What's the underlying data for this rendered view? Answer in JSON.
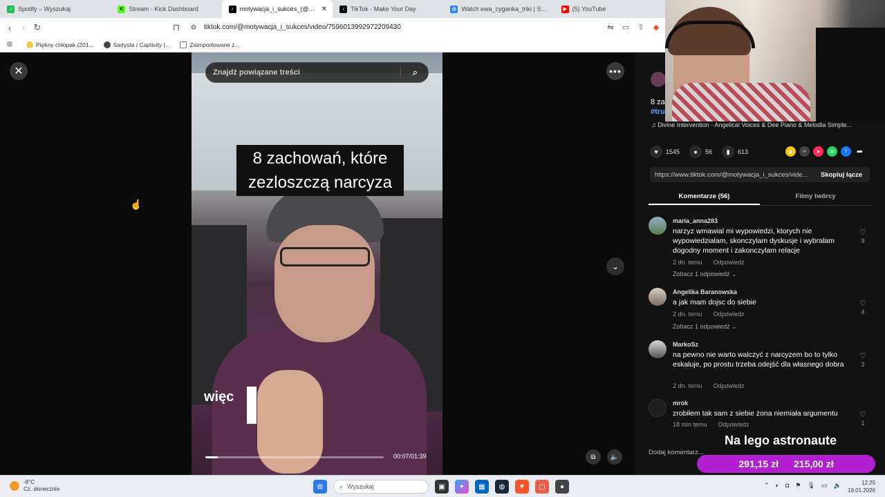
{
  "browser": {
    "tabs": [
      {
        "title": "Spotify – Wyszukaj",
        "color": "#1db954",
        "glyph": "♫"
      },
      {
        "title": "Stream - Kick Dashboard",
        "color": "#53fc18",
        "glyph": "K"
      },
      {
        "title": "motywacja_i_sukces_(@mot",
        "color": "#000000",
        "glyph": "♪",
        "active": true
      },
      {
        "title": "TikTok - Make Your Day",
        "color": "#000000",
        "glyph": "♪"
      },
      {
        "title": "Watch ewa_cyganka_triki | Streamab",
        "color": "#2b80ff",
        "glyph": "◎"
      },
      {
        "title": "(5) YouTube",
        "color": "#ff0000",
        "glyph": "▶"
      }
    ],
    "url": "tiktok.com/@motywacja_i_sukces/video/7596013992972209430",
    "bookmarks": [
      {
        "label": "Piękny chłopak (201...",
        "color": "#f2c94c"
      },
      {
        "label": "Sadysta / Captivity (...",
        "color": "#444444"
      },
      {
        "label": "Zaimportowane z...",
        "color": "#888888"
      }
    ]
  },
  "viewer": {
    "search_placeholder": "Znajdź powiązane treści",
    "caption": "8 zachowań, które zezloszczą narcyza",
    "subtitle": "więc",
    "time": "00:07/01:39",
    "progress_fraction": 0.07
  },
  "panel": {
    "title_fragment": "8 za",
    "hashtag_fragment": "#tru",
    "music": "♫  Divine Intervention - Angelical Voices & Dee Piano & Melodia Simple...",
    "stats": {
      "likes": "1545",
      "comments": "56",
      "saves": "613"
    },
    "link": "https://www.tiktok.com/@motywacja_i_sukces/vide...",
    "copy_label": "Skopiuj łącze",
    "tabs": {
      "comments": "Komentarze (56)",
      "creator_videos": "Filmy twórcy"
    },
    "comments": [
      {
        "user": "maria_anna283",
        "text": "narzyz wmawial mi wypowiedzi, ktorych nie wypowiedzialam, skonczylam dyskusje i wybralam dogodny moment i zakonczylam relacje",
        "time": "2 dn. temu",
        "reply": "Odpowiedz",
        "likes": "9",
        "more": "Zobacz 1 odpowiedź ⌄",
        "avatar": "#6b8fa0"
      },
      {
        "user": "Angelika Baranowska",
        "text": "a jak mam dojsc do siebie",
        "time": "2 dn. temu",
        "reply": "Odpowiedz",
        "likes": "4",
        "more": "Zobacz 1 odpowiedź ⌄",
        "avatar": "#c3b2a0"
      },
      {
        "user": "MarkoSz",
        "text": "na pewno nie warto walczyć z narcyzem bo to tylko eskaluje, po prostu trzeba odejść dla własnego dobra",
        "time": "2 dn. temu",
        "reply": "Odpowiedz",
        "likes": "3",
        "more": "",
        "avatar": "#8c8c8c"
      },
      {
        "user": "mrok",
        "text": "zrobiłem tak sam z siebie żona niemiała argumentu",
        "time": "18 min temu",
        "reply": "Odpowiedz",
        "likes": "1",
        "more": "",
        "avatar": "#2a2a2a"
      }
    ],
    "add_comment": "Dodaj komentarz..."
  },
  "overlay": {
    "donation_title": "Na lego astronaute",
    "amount_current": "291,15 zł",
    "amount_goal": "215,00 zł"
  },
  "taskbar": {
    "temperature": "-8°C",
    "weather": "Cz. słonecznie",
    "search": "Wyszukaj",
    "time": "12:25",
    "date": "19.01.2026"
  }
}
